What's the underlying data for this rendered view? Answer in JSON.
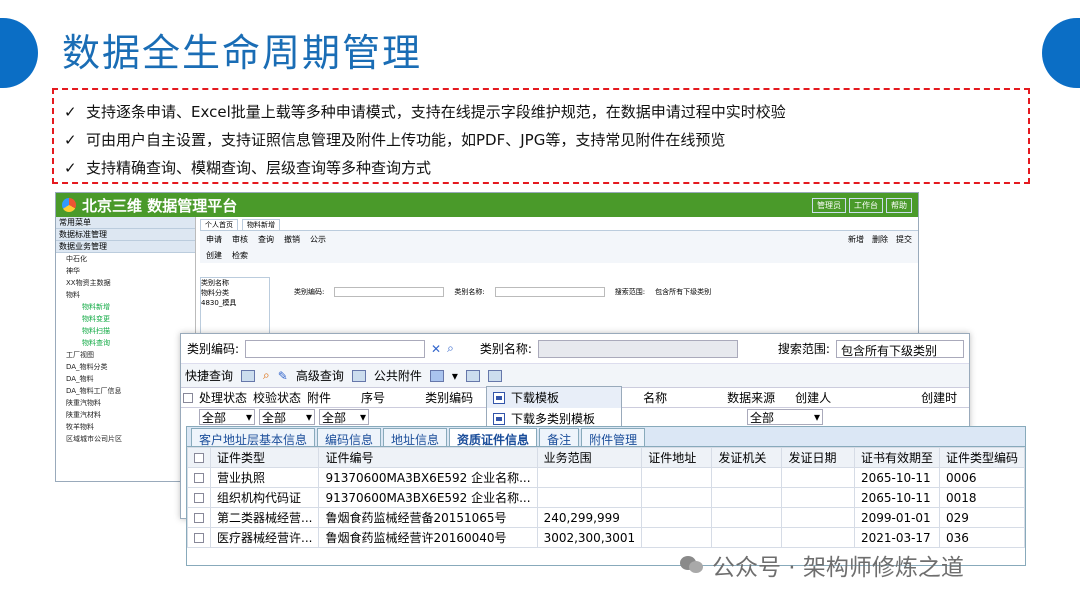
{
  "slide": {
    "title": "数据全生命周期管理",
    "bullets": [
      "支持逐条申请、Excel批量上载等多种申请模式，支持在线提示字段维护规范，在数据申请过程中实时校验",
      "可由用户自主设置，支持证照信息管理及附件上传功能，如PDF、JPG等，支持常见附件在线预览",
      "支持精确查询、模糊查询、层级查询等多种查询方式"
    ],
    "check_mark": "✓",
    "watermark": "公众号 · 架构师修炼之道"
  },
  "back_window": {
    "app_title": "北京三维 数据管理平台",
    "header_buttons": [
      "管理员",
      "工作台",
      "帮助"
    ],
    "nav_headers": [
      "常用菜单",
      "数据标准管理",
      "数据业务管理"
    ],
    "nav_items": [
      "中石化",
      "神华",
      "XX物资主数据",
      "物料"
    ],
    "nav_sub_items": [
      "物料新增",
      "物料变更",
      "物料扫描",
      "物料查询"
    ],
    "nav_items2": [
      "工厂视图",
      "DA_物料分类",
      "DA_物料",
      "DA_物料工厂信息",
      "陕重汽物料",
      "陕重汽材料",
      "牧羊物料",
      "区域城市公司片区"
    ],
    "tabs": [
      "个人首页",
      "物料新增"
    ],
    "subbar": [
      "申请",
      "审核",
      "查询",
      "撤销",
      "公示"
    ],
    "subbar_right": [
      "新增",
      "删除",
      "提交"
    ],
    "sub_tabs": [
      "创建",
      "检索"
    ],
    "left_grid_title": "类别名称",
    "left_grid_items": [
      "物料分类",
      "4830_模具"
    ],
    "field_labels": [
      "类别编码:",
      "类别名称:",
      "搜索范围:"
    ],
    "scope_value": "包含所有下级类别"
  },
  "front_window": {
    "labels": {
      "code": "类别编码:",
      "name": "类别名称:",
      "scope": "搜索范围:"
    },
    "scope_value": "包含所有下级类别",
    "toolbar": {
      "quick": "快捷查询",
      "advanced": "高级查询",
      "attach": "公共附件"
    },
    "columns": [
      "处理状态",
      "校验状态",
      "附件",
      "序号",
      "类别编码",
      "名称",
      "数据来源",
      "创建人",
      "创建时"
    ],
    "filters": {
      "status": "全部",
      "check": "全部",
      "attach": "全部",
      "source": "全部"
    }
  },
  "menu": {
    "items": [
      "下载模板",
      "下载多类别模板"
    ]
  },
  "detail_panel": {
    "tabs": [
      "客户地址层基本信息",
      "编码信息",
      "地址信息",
      "资质证件信息",
      "备注",
      "附件管理"
    ],
    "active_tab": 3,
    "columns": [
      "证件类型",
      "证件编号",
      "业务范围",
      "证件地址",
      "发证机关",
      "发证日期",
      "证书有效期至",
      "证件类型编码"
    ],
    "rows": [
      [
        "营业执照",
        "91370600MA3BX6E592 企业名称...",
        "",
        "",
        "",
        "",
        "2065-10-11",
        "0006"
      ],
      [
        "组织机构代码证",
        "91370600MA3BX6E592 企业名称...",
        "",
        "",
        "",
        "",
        "2065-10-11",
        "0018"
      ],
      [
        "第二类器械经营...",
        "鲁烟食药监械经营备20151065号",
        "240,299,999",
        "",
        "",
        "",
        "2099-01-01",
        "029"
      ],
      [
        "医疗器械经营许...",
        "鲁烟食药监械经营许20160040号",
        "3002,300,3001",
        "",
        "",
        "",
        "2021-03-17",
        "036"
      ]
    ]
  },
  "colors": {
    "accent": "#1a6db5",
    "header_green": "#4a9a2a",
    "dash_red": "#e5191f"
  }
}
